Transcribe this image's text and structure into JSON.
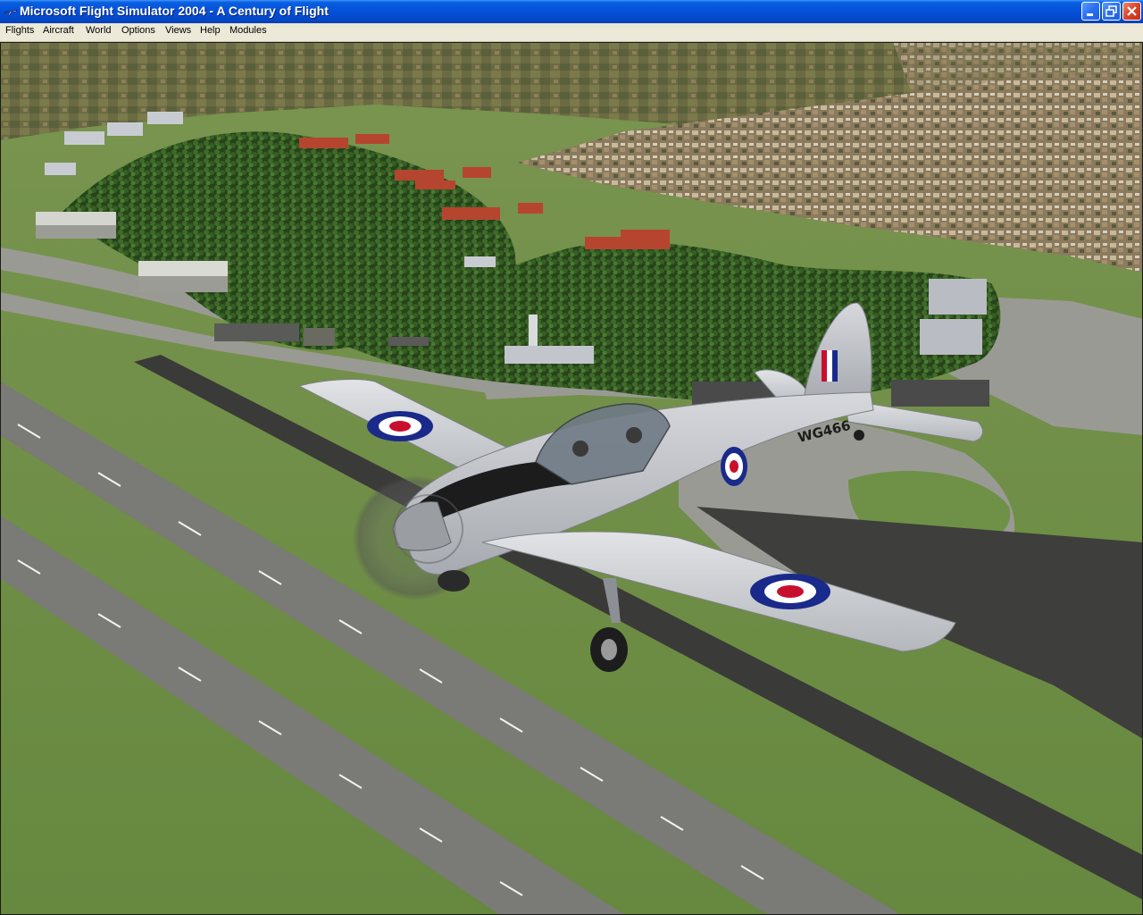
{
  "window": {
    "title": "Microsoft Flight Simulator 2004 - A Century of Flight",
    "controls": [
      "minimize-icon",
      "restore-icon",
      "close-icon"
    ]
  },
  "menu": {
    "items": [
      {
        "label": "Flights"
      },
      {
        "label": "Aircraft"
      },
      {
        "label": "World"
      },
      {
        "label": "Options"
      },
      {
        "label": "Views"
      },
      {
        "label": "Help"
      },
      {
        "label": "Modules"
      }
    ]
  },
  "scene": {
    "aircraft": {
      "registration": "WG466",
      "roundel_colors": [
        "#1a2a8a",
        "#ffffff",
        "#c8102e"
      ],
      "fin_flash_colors": [
        "#c8102e",
        "#ffffff",
        "#1a2a8a"
      ]
    },
    "colors": {
      "grass": "#6f8f47",
      "tarmac": "#9a9a94",
      "forest": "#2f4f1c",
      "roof_red": "#b5452f",
      "fuselage": "#c9cbcf"
    }
  }
}
